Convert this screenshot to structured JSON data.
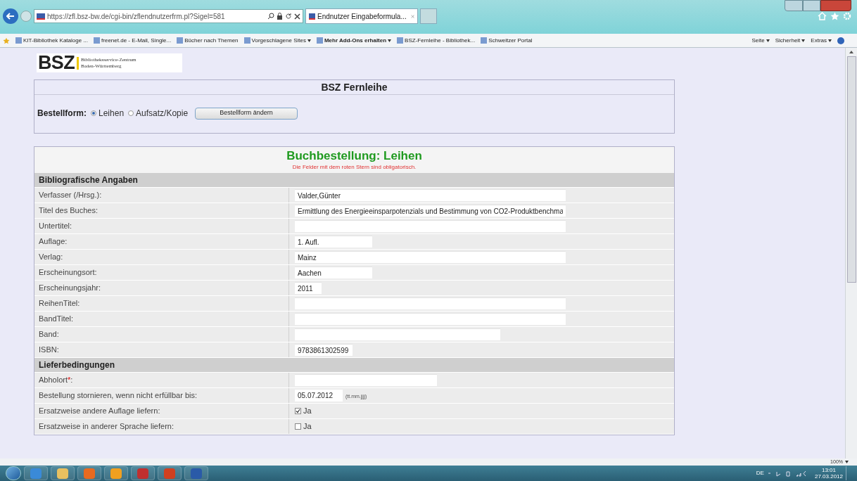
{
  "browser": {
    "address": "https://zfl.bsz-bw.de/cgi-bin/zflendnutzerfrm.pl?Sigel=581",
    "tabs": [
      {
        "label": "Endnutzer Eingabeformula...",
        "selected": true
      }
    ],
    "favorites": [
      {
        "label": "KIT-Bibliothek Kataloge ...",
        "bold": false,
        "menu": false
      },
      {
        "label": "freenet.de - E-Mail, Single...",
        "bold": false,
        "menu": false
      },
      {
        "label": "Bücher nach Themen",
        "bold": false,
        "menu": false
      },
      {
        "label": "Vorgeschlagene Sites",
        "bold": false,
        "menu": true
      },
      {
        "label": "Mehr Add-Ons erhalten",
        "bold": true,
        "menu": true
      },
      {
        "label": "BSZ-Fernleihe - Bibliothek...",
        "bold": false,
        "menu": false
      },
      {
        "label": "Schweitzer Portal",
        "bold": false,
        "menu": false
      }
    ],
    "commands": [
      "Seite",
      "Sicherheit",
      "Extras"
    ],
    "zoom": "100%"
  },
  "logo": {
    "letters": "BSZ",
    "line1": "Bibliotheksservice-Zentrum",
    "line2": "Baden-Württemberg"
  },
  "header": {
    "title": "BSZ Fernleihe",
    "label": "Bestellform:",
    "options": [
      {
        "label": "Leihen",
        "selected": true
      },
      {
        "label": "Aufsatz/Kopie",
        "selected": false
      }
    ],
    "button": "Bestellform ändern"
  },
  "form": {
    "title": "Buchbestellung: Leihen",
    "note": "Die Felder mit dem roten Stern sind obligatorisch.",
    "sections": [
      {
        "title": "Bibliografische Angaben",
        "rows": [
          {
            "kind": "text",
            "label": "Verfasser (/Hrsg.):",
            "value": "Valder,Günter"
          },
          {
            "kind": "text",
            "label": "Titel des Buches:",
            "value": "Ermittlung des Energieeinsparpotenzials und Bestimmung von CO2-Produktbenchma"
          },
          {
            "kind": "text",
            "label": "Untertitel:",
            "value": ""
          },
          {
            "kind": "text",
            "label": "Auflage:",
            "value": "1. Aufl."
          },
          {
            "kind": "text",
            "label": "Verlag:",
            "value": "Mainz"
          },
          {
            "kind": "text",
            "label": "Erscheinungsort:",
            "value": "Aachen"
          },
          {
            "kind": "text",
            "label": "Erscheinungsjahr:",
            "value": "2011"
          },
          {
            "kind": "text",
            "label": "ReihenTitel:",
            "value": ""
          },
          {
            "kind": "text",
            "label": "BandTitel:",
            "value": ""
          },
          {
            "kind": "text",
            "label": "Band:",
            "value": ""
          },
          {
            "kind": "text",
            "label": "ISBN:",
            "value": "9783861302599"
          }
        ]
      },
      {
        "title": "Lieferbedingungen",
        "rows": [
          {
            "kind": "text",
            "label": "Abholort",
            "required_mark": "*",
            "label_end": ":",
            "value": ""
          },
          {
            "kind": "date",
            "label": "Bestellung stornieren, wenn nicht erfüllbar bis:",
            "value": "05.07.2012",
            "hint": "(tt.mm.jjjj)"
          },
          {
            "kind": "checkbox",
            "label": "Ersatzweise andere Auflage liefern:",
            "option": "Ja",
            "checked": true
          },
          {
            "kind": "checkbox",
            "label": "Ersatzweise in anderer Sprache liefern:",
            "option": "Ja",
            "checked": false
          }
        ]
      }
    ]
  },
  "taskbar": {
    "language": "DE",
    "time": "13:01",
    "date": "27.03.2012"
  }
}
